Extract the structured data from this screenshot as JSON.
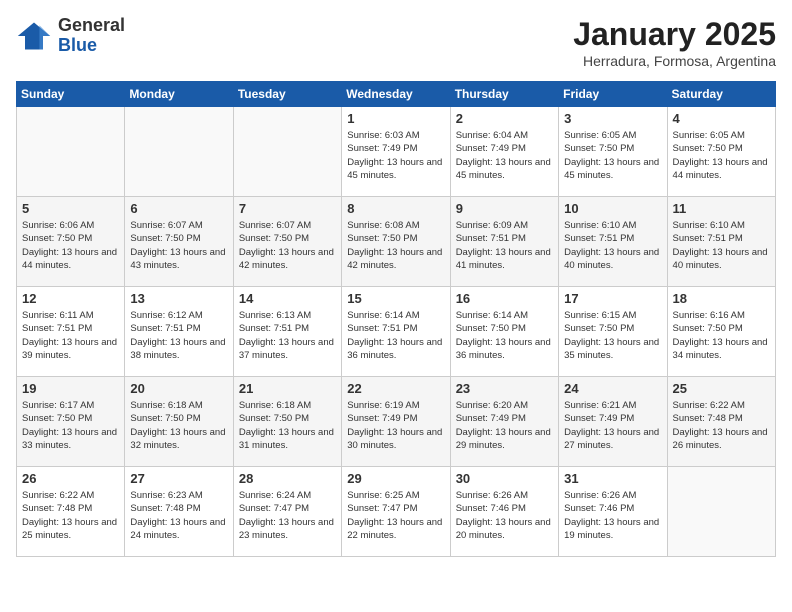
{
  "logo": {
    "general": "General",
    "blue": "Blue"
  },
  "title": "January 2025",
  "subtitle": "Herradura, Formosa, Argentina",
  "days_of_week": [
    "Sunday",
    "Monday",
    "Tuesday",
    "Wednesday",
    "Thursday",
    "Friday",
    "Saturday"
  ],
  "weeks": [
    [
      {
        "day": "",
        "content": ""
      },
      {
        "day": "",
        "content": ""
      },
      {
        "day": "",
        "content": ""
      },
      {
        "day": "1",
        "content": "Sunrise: 6:03 AM\nSunset: 7:49 PM\nDaylight: 13 hours and 45 minutes."
      },
      {
        "day": "2",
        "content": "Sunrise: 6:04 AM\nSunset: 7:49 PM\nDaylight: 13 hours and 45 minutes."
      },
      {
        "day": "3",
        "content": "Sunrise: 6:05 AM\nSunset: 7:50 PM\nDaylight: 13 hours and 45 minutes."
      },
      {
        "day": "4",
        "content": "Sunrise: 6:05 AM\nSunset: 7:50 PM\nDaylight: 13 hours and 44 minutes."
      }
    ],
    [
      {
        "day": "5",
        "content": "Sunrise: 6:06 AM\nSunset: 7:50 PM\nDaylight: 13 hours and 44 minutes."
      },
      {
        "day": "6",
        "content": "Sunrise: 6:07 AM\nSunset: 7:50 PM\nDaylight: 13 hours and 43 minutes."
      },
      {
        "day": "7",
        "content": "Sunrise: 6:07 AM\nSunset: 7:50 PM\nDaylight: 13 hours and 42 minutes."
      },
      {
        "day": "8",
        "content": "Sunrise: 6:08 AM\nSunset: 7:50 PM\nDaylight: 13 hours and 42 minutes."
      },
      {
        "day": "9",
        "content": "Sunrise: 6:09 AM\nSunset: 7:51 PM\nDaylight: 13 hours and 41 minutes."
      },
      {
        "day": "10",
        "content": "Sunrise: 6:10 AM\nSunset: 7:51 PM\nDaylight: 13 hours and 40 minutes."
      },
      {
        "day": "11",
        "content": "Sunrise: 6:10 AM\nSunset: 7:51 PM\nDaylight: 13 hours and 40 minutes."
      }
    ],
    [
      {
        "day": "12",
        "content": "Sunrise: 6:11 AM\nSunset: 7:51 PM\nDaylight: 13 hours and 39 minutes."
      },
      {
        "day": "13",
        "content": "Sunrise: 6:12 AM\nSunset: 7:51 PM\nDaylight: 13 hours and 38 minutes."
      },
      {
        "day": "14",
        "content": "Sunrise: 6:13 AM\nSunset: 7:51 PM\nDaylight: 13 hours and 37 minutes."
      },
      {
        "day": "15",
        "content": "Sunrise: 6:14 AM\nSunset: 7:51 PM\nDaylight: 13 hours and 36 minutes."
      },
      {
        "day": "16",
        "content": "Sunrise: 6:14 AM\nSunset: 7:50 PM\nDaylight: 13 hours and 36 minutes."
      },
      {
        "day": "17",
        "content": "Sunrise: 6:15 AM\nSunset: 7:50 PM\nDaylight: 13 hours and 35 minutes."
      },
      {
        "day": "18",
        "content": "Sunrise: 6:16 AM\nSunset: 7:50 PM\nDaylight: 13 hours and 34 minutes."
      }
    ],
    [
      {
        "day": "19",
        "content": "Sunrise: 6:17 AM\nSunset: 7:50 PM\nDaylight: 13 hours and 33 minutes."
      },
      {
        "day": "20",
        "content": "Sunrise: 6:18 AM\nSunset: 7:50 PM\nDaylight: 13 hours and 32 minutes."
      },
      {
        "day": "21",
        "content": "Sunrise: 6:18 AM\nSunset: 7:50 PM\nDaylight: 13 hours and 31 minutes."
      },
      {
        "day": "22",
        "content": "Sunrise: 6:19 AM\nSunset: 7:49 PM\nDaylight: 13 hours and 30 minutes."
      },
      {
        "day": "23",
        "content": "Sunrise: 6:20 AM\nSunset: 7:49 PM\nDaylight: 13 hours and 29 minutes."
      },
      {
        "day": "24",
        "content": "Sunrise: 6:21 AM\nSunset: 7:49 PM\nDaylight: 13 hours and 27 minutes."
      },
      {
        "day": "25",
        "content": "Sunrise: 6:22 AM\nSunset: 7:48 PM\nDaylight: 13 hours and 26 minutes."
      }
    ],
    [
      {
        "day": "26",
        "content": "Sunrise: 6:22 AM\nSunset: 7:48 PM\nDaylight: 13 hours and 25 minutes."
      },
      {
        "day": "27",
        "content": "Sunrise: 6:23 AM\nSunset: 7:48 PM\nDaylight: 13 hours and 24 minutes."
      },
      {
        "day": "28",
        "content": "Sunrise: 6:24 AM\nSunset: 7:47 PM\nDaylight: 13 hours and 23 minutes."
      },
      {
        "day": "29",
        "content": "Sunrise: 6:25 AM\nSunset: 7:47 PM\nDaylight: 13 hours and 22 minutes."
      },
      {
        "day": "30",
        "content": "Sunrise: 6:26 AM\nSunset: 7:46 PM\nDaylight: 13 hours and 20 minutes."
      },
      {
        "day": "31",
        "content": "Sunrise: 6:26 AM\nSunset: 7:46 PM\nDaylight: 13 hours and 19 minutes."
      },
      {
        "day": "",
        "content": ""
      }
    ]
  ]
}
